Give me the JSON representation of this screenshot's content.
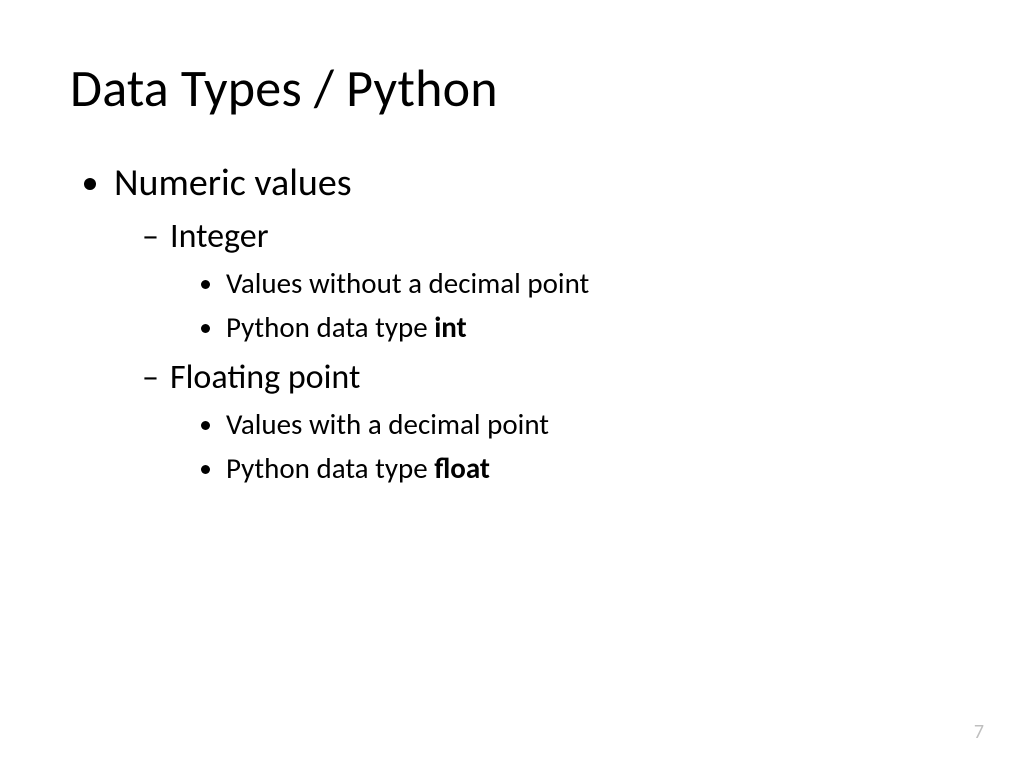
{
  "title": "Data Types / Python",
  "bullets": {
    "l1_0": "Numeric values",
    "l2_0": "Integer",
    "l3_0_0": "Values without a decimal point",
    "l3_0_1_pre": "Python data type ",
    "l3_0_1_bold": "int",
    "l2_1": "Floating point",
    "l3_1_0": "Values with a decimal point",
    "l3_1_1_pre": "Python data type ",
    "l3_1_1_bold": "float"
  },
  "page_number": "7"
}
